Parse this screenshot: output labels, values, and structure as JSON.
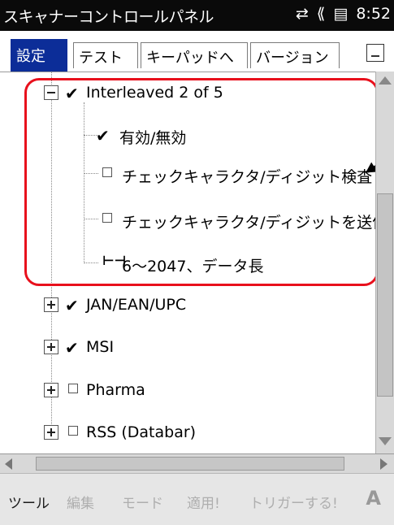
{
  "titlebar": {
    "title": "スキャナーコントロールパネル",
    "time": "8:52",
    "icons": [
      "connectivity-icon",
      "volume-icon",
      "battery-icon"
    ]
  },
  "tabs": [
    "設定",
    "テスト",
    "キーパッドへ",
    "バージョン"
  ],
  "tree": {
    "interleaved": {
      "label": "Interleaved 2 of 5",
      "enabled_label": "有効/無効",
      "check_digit_verify": "チェックキャラクタ/ディジット検査",
      "check_digit_send": "チェックキャラクタ/ディジットを送信",
      "length": "6〜2047、データ長"
    },
    "jan": "JAN/EAN/UPC",
    "msi": "MSI",
    "pharma": "Pharma",
    "rss": "RSS (Databar)"
  },
  "menu": {
    "tool": "ツール",
    "edit": "編集",
    "mode": "モード",
    "apply": "適用!",
    "trigger": "トリガーする!",
    "ime": "A"
  },
  "colors": {
    "accent": "#0c2d98",
    "highlight": "#e8101c"
  }
}
